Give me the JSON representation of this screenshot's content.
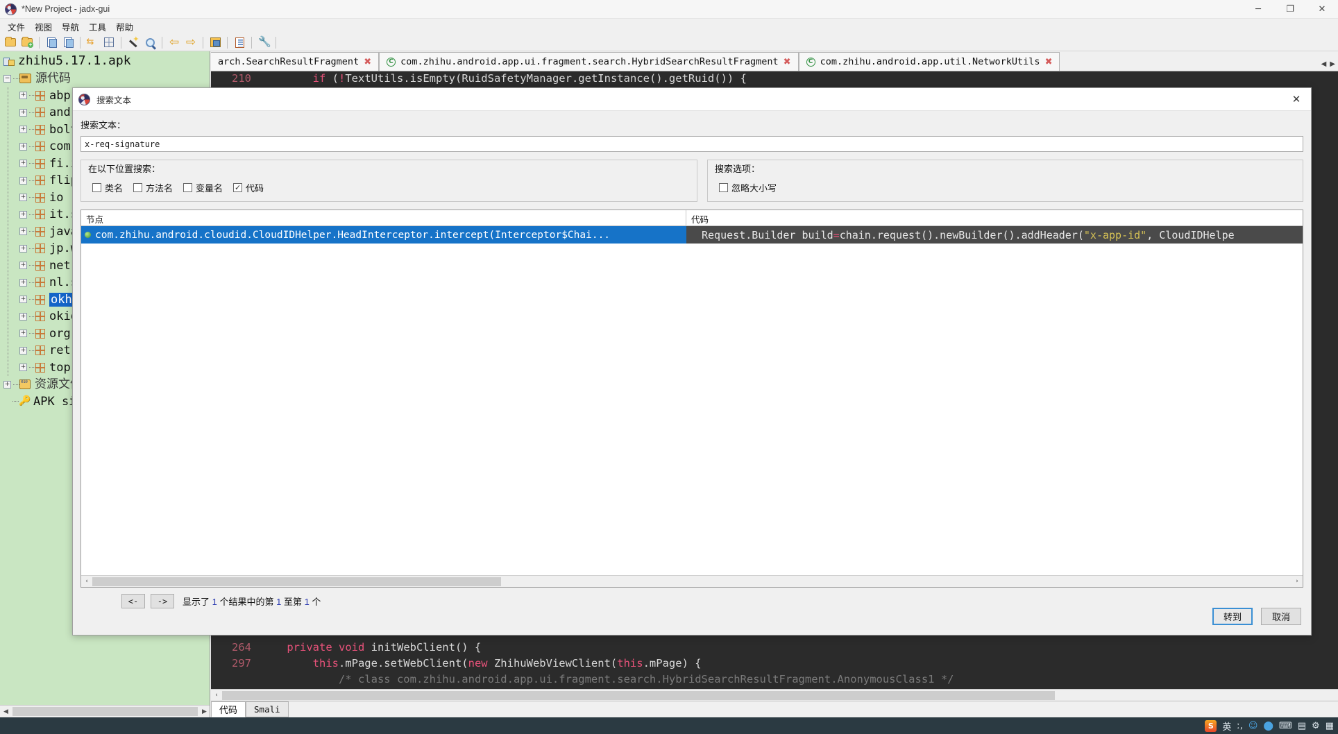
{
  "window": {
    "title": "*New Project - jadx-gui",
    "app_icon": "jadx-logo-icon",
    "minimize_label": "─",
    "maximize_label": "❐",
    "close_label": "✕"
  },
  "menubar": {
    "items": [
      {
        "label": "文件",
        "name": "menu-file"
      },
      {
        "label": "视图",
        "name": "menu-view"
      },
      {
        "label": "导航",
        "name": "menu-navigation"
      },
      {
        "label": "工具",
        "name": "menu-tools"
      },
      {
        "label": "帮助",
        "name": "menu-help"
      }
    ]
  },
  "toolbar": {
    "buttons": [
      {
        "name": "open-file-icon",
        "kind": "folder"
      },
      {
        "name": "open-project-icon",
        "kind": "folder-add"
      },
      {
        "sep": true
      },
      {
        "name": "copy-icon",
        "kind": "docs"
      },
      {
        "name": "save-all-icon",
        "kind": "docs-save"
      },
      {
        "sep": true
      },
      {
        "name": "sync-icon",
        "kind": "arrows"
      },
      {
        "name": "deobfuscation-icon",
        "kind": "grid"
      },
      {
        "sep": true
      },
      {
        "name": "magic-wand-icon",
        "kind": "wand"
      },
      {
        "name": "search-icon",
        "kind": "magnifier"
      },
      {
        "sep": true
      },
      {
        "name": "back-arrow-icon",
        "kind": "arrow-left"
      },
      {
        "name": "forward-arrow-icon",
        "kind": "arrow-right"
      },
      {
        "sep": true
      },
      {
        "name": "decompile-icon",
        "kind": "package"
      },
      {
        "sep": true
      },
      {
        "name": "log-viewer-icon",
        "kind": "notes"
      },
      {
        "sep": true
      },
      {
        "name": "preferences-icon",
        "kind": "wrench"
      },
      {
        "sep": true
      }
    ]
  },
  "sidebar": {
    "root": {
      "label": "zhihu5.17.1.apk",
      "icon": "apk-icon"
    },
    "source_node": {
      "label": "源代码",
      "icon": "source-folder-icon",
      "expander": "−"
    },
    "packages": [
      {
        "label": "abp"
      },
      {
        "label": "andr"
      },
      {
        "label": "bolt"
      },
      {
        "label": "com"
      },
      {
        "label": "fi.i"
      },
      {
        "label": "flip"
      },
      {
        "label": "io"
      },
      {
        "label": "it.s"
      },
      {
        "label": "java"
      },
      {
        "label": "jp.w"
      },
      {
        "label": "net."
      },
      {
        "label": "nl.s"
      },
      {
        "label": "okht",
        "selected": true
      },
      {
        "label": "okio"
      },
      {
        "label": "org"
      },
      {
        "label": "retr"
      },
      {
        "label": "top."
      }
    ],
    "resources_node": {
      "label": "资源文件",
      "icon": "resources-folder-icon"
    },
    "apk_signature_node": {
      "label": "APK si",
      "icon": "key-icon"
    },
    "hscroll": {
      "left_arrow": "◀",
      "right_arrow": "▶"
    }
  },
  "editor": {
    "tabs": [
      {
        "label": "arch.SearchResultFragment",
        "close": "✖",
        "icon": null,
        "active": false
      },
      {
        "label": "com.zhihu.android.app.ui.fragment.search.HybridSearchResultFragment",
        "close": "✖",
        "icon": "class-icon",
        "active": false
      },
      {
        "label": "com.zhihu.android.app.util.NetworkUtils",
        "close": "✖",
        "icon": "class-icon",
        "active": true
      }
    ],
    "tab_nav": {
      "left": "◀",
      "right": "▶"
    },
    "code_top": [
      {
        "line": "210",
        "segments": [
          {
            "t": "        ",
            "c": "plain"
          },
          {
            "t": "if",
            "c": "kw2"
          },
          {
            "t": " (",
            "c": "plain"
          },
          {
            "t": "!",
            "c": "kw2"
          },
          {
            "t": "TextUtils.isEmpty(RuidSafetyManager.getInstance().getRuid())) {",
            "c": "plain"
          }
        ]
      }
    ],
    "code_bottom": [
      {
        "line": "",
        "segments": [
          {
            "t": "        }",
            "c": "plain"
          }
        ]
      },
      {
        "line": "",
        "segments": [
          {
            "t": "",
            "c": "plain"
          }
        ]
      },
      {
        "line": "264",
        "segments": [
          {
            "t": "    ",
            "c": "plain"
          },
          {
            "t": "private void ",
            "c": "kw2"
          },
          {
            "t": "initWebClient() {",
            "c": "plain"
          }
        ]
      },
      {
        "line": "297",
        "segments": [
          {
            "t": "        ",
            "c": "plain"
          },
          {
            "t": "this",
            "c": "kw2"
          },
          {
            "t": ".mPage.setWebClient(",
            "c": "plain"
          },
          {
            "t": "new ",
            "c": "kw2"
          },
          {
            "t": "ZhihuWebViewClient(",
            "c": "plain"
          },
          {
            "t": "this",
            "c": "kw2"
          },
          {
            "t": ".mPage) {",
            "c": "plain"
          }
        ]
      },
      {
        "line": "",
        "segments": [
          {
            "t": "            /* class com.zhihu.android.app.ui.fragment.search.HybridSearchResultFragment.AnonymousClass1 */",
            "c": "cmt"
          }
        ]
      }
    ],
    "bottom_tabs": [
      {
        "label": "代码",
        "active": true
      },
      {
        "label": "Smali",
        "active": false
      }
    ]
  },
  "dialog": {
    "title": "搜索文本",
    "icon": "jadx-logo-icon",
    "close_label": "✕",
    "search_label": "搜索文本：",
    "search_value": "x-req-signature",
    "search_placeholder": "",
    "search_in": {
      "legend": "在以下位置搜索：",
      "checkboxes": [
        {
          "label": "类名",
          "checked": false,
          "name": "checkbox-class-name"
        },
        {
          "label": "方法名",
          "checked": false,
          "name": "checkbox-method-name"
        },
        {
          "label": "变量名",
          "checked": false,
          "name": "checkbox-field-name"
        },
        {
          "label": "代码",
          "checked": true,
          "name": "checkbox-code"
        }
      ]
    },
    "search_options": {
      "legend": "搜索选项：",
      "checkboxes": [
        {
          "label": "忽略大小写",
          "checked": false,
          "name": "checkbox-ignore-case"
        }
      ]
    },
    "results": {
      "headers": [
        "节点",
        "代码"
      ],
      "rows": [
        {
          "node": "com.zhihu.android.cloudid.CloudIDHelper.HeadInterceptor.intercept(Interceptor$Chai...",
          "code_segments": [
            {
              "t": "Request.Builder build ",
              "c": "c-plain"
            },
            {
              "t": "=",
              "c": "c-op"
            },
            {
              "t": " chain.request().newBuilder().addHeader(",
              "c": "c-plain"
            },
            {
              "t": "\"x-app-id\"",
              "c": "c-str"
            },
            {
              "t": ", CloudIDHelpe",
              "c": "c-plain"
            }
          ],
          "selected": true
        }
      ]
    },
    "pager": {
      "prev_label": "<-",
      "next_label": "->",
      "status_parts": [
        {
          "t": "显示了 ",
          "c": ""
        },
        {
          "t": "1",
          "c": "num"
        },
        {
          "t": " 个结果中的第 ",
          "c": ""
        },
        {
          "t": "1",
          "c": "num"
        },
        {
          "t": " 至第 ",
          "c": ""
        },
        {
          "t": "1",
          "c": "num"
        },
        {
          "t": " 个",
          "c": ""
        }
      ],
      "status_text": "显示了 1 个结果中的第 1 至第 1 个"
    },
    "buttons": {
      "goto": "转到",
      "cancel": "取消"
    },
    "hscroll": {
      "left_arrow": "‹",
      "right_arrow": "›"
    }
  },
  "taskbar": {
    "tray": [
      {
        "name": "sogou-input-icon",
        "glyph": "S"
      },
      {
        "name": "language-icon",
        "glyph": "英"
      },
      {
        "name": "comma-icon",
        "glyph": "ː,"
      },
      {
        "name": "emoji-icon",
        "glyph": "☺"
      },
      {
        "name": "mic-icon",
        "glyph": "⬤"
      },
      {
        "name": "keyboard-icon",
        "glyph": "⌨"
      },
      {
        "name": "toolbox-icon",
        "glyph": "▤"
      },
      {
        "name": "settings-icon",
        "glyph": "⚙"
      },
      {
        "name": "grid-icon",
        "glyph": "▦"
      }
    ]
  },
  "colors": {
    "sidebar_bg": "#c9e6c2",
    "selection_blue": "#1464c8",
    "code_bg": "#2b2b2b",
    "result_code_bg": "#4a4a4a",
    "accent": "#3a8fd4"
  }
}
